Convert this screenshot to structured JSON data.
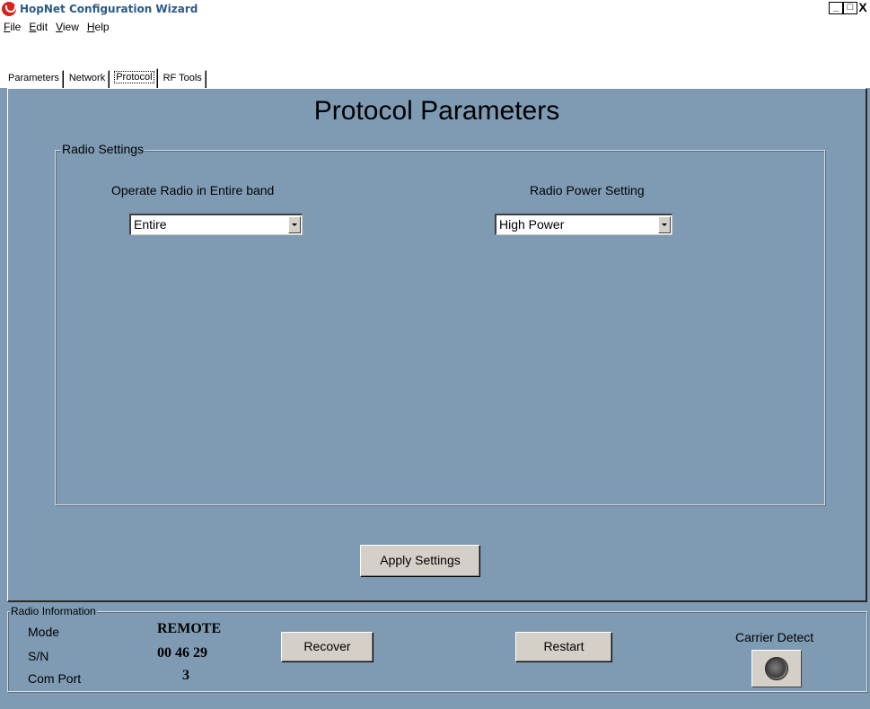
{
  "window": {
    "title": "HopNet Configuration Wizard",
    "controls": [
      "_",
      "□",
      "X"
    ]
  },
  "menu": [
    {
      "label": "File",
      "accel": "F"
    },
    {
      "label": "Edit",
      "accel": "E"
    },
    {
      "label": "View",
      "accel": "V"
    },
    {
      "label": "Help",
      "accel": "H"
    }
  ],
  "tabs": [
    {
      "label": "Parameters",
      "active": false
    },
    {
      "label": "Network",
      "active": false
    },
    {
      "label": "Protocol",
      "active": true
    },
    {
      "label": "RF Tools",
      "active": false
    }
  ],
  "main": {
    "title": "Protocol Parameters",
    "group_label": "Radio Settings",
    "band_label": "Operate Radio in Entire band",
    "band_value": "Entire",
    "power_label": "Radio Power Setting",
    "power_value": "High Power",
    "apply_label": "Apply Settings"
  },
  "radio_info": {
    "group_label": "Radio Information",
    "mode_label": "Mode",
    "mode_value": "REMOTE",
    "sn_label": "S/N",
    "sn_value": "00 46 29",
    "port_label": "Com Port",
    "port_value": "3",
    "recover_label": "Recover",
    "restart_label": "Restart",
    "carrier_label": "Carrier Detect"
  },
  "colors": {
    "background": "#7f9bb3",
    "title_text": "#2b5a8a",
    "app_icon": "#d9201a"
  }
}
